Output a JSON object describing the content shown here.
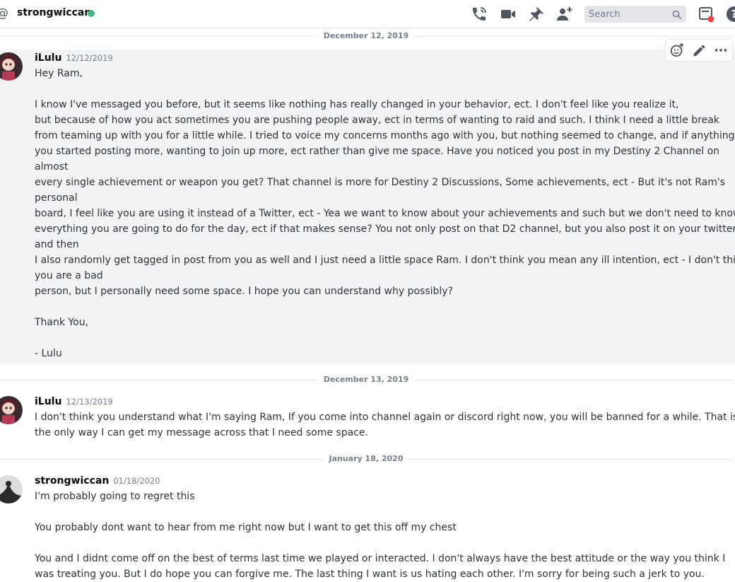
{
  "header": {
    "channel_name": "strongwiccan",
    "status": "online",
    "search_placeholder": "Search",
    "icons": [
      "at-icon",
      "call-icon",
      "video-icon",
      "pin-icon",
      "add-friend-icon",
      "search-icon",
      "inbox-icon",
      "help-icon"
    ]
  },
  "colors": {
    "online": "#43b581",
    "notification": "#f04747",
    "hover_bg": "#f2f3f5"
  },
  "dividers": [
    "December 12, 2019",
    "December 13, 2019",
    "January 18, 2020"
  ],
  "messages": [
    {
      "author": "iLulu",
      "timestamp": "12/12/2019",
      "lines": [
        "Hey Ram,",
        "",
        "I know I've messaged you before, but it seems like nothing has really changed in your behavior, ect. I don't feel like you realize it,",
        "but because of how you act sometimes you are pushing people away, ect in terms of wanting to raid and such. I think I need a little break",
        "from teaming up with you for a little while. I tried to voice my concerns months ago with you, but nothing seemed to change, and if anything",
        "you started posting more, wanting to join up more, ect rather than give me space. Have you noticed you post in my Destiny 2 Channel on",
        "almost",
        "every single achievement or weapon you get? That channel is more for Destiny 2 Discussions, Some achievements, ect - But it's not Ram's",
        "personal",
        "board, I feel like you are using it instead of a Twitter, ect - Yea we want to know about your achievements and such but we don't need to know",
        "everything you are going to do for the day, ect if that makes sense? You not only post on that D2 channel, but you also post it on your twitter,",
        "and then",
        "I also randomly get tagged in post from you as well and I just need a little space Ram. I don't think you mean any ill intention, ect - I don't think",
        "you are a bad",
        "person, but I personally need some space. I hope you can understand why possibly?",
        "",
        "Thank You,",
        "",
        "- Lulu"
      ]
    },
    {
      "author": "iLulu",
      "timestamp": "12/13/2019",
      "lines": [
        "I don't think you understand what I'm saying Ram, If you come into channel again or discord right now, you will be banned for a while. That is",
        "the only way I can get my message across that I need some space."
      ]
    },
    {
      "author": "strongwiccan",
      "timestamp": "01/18/2020",
      "lines": [
        "I'm probably going to regret this",
        "",
        "You probably dont want to hear from me right now but I want to get this off my chest",
        "",
        "You and I didnt come off on the best of terms last time we played or interacted. I don't always have the best attitude or the way you think I",
        "was treating you. But I do hope you can forgive me. The last thing I want is us hating each other. I'm sorry for being such a jerk to you."
      ]
    }
  ],
  "message_actions": [
    "add-reaction-icon",
    "edit-icon",
    "more-options-icon"
  ]
}
